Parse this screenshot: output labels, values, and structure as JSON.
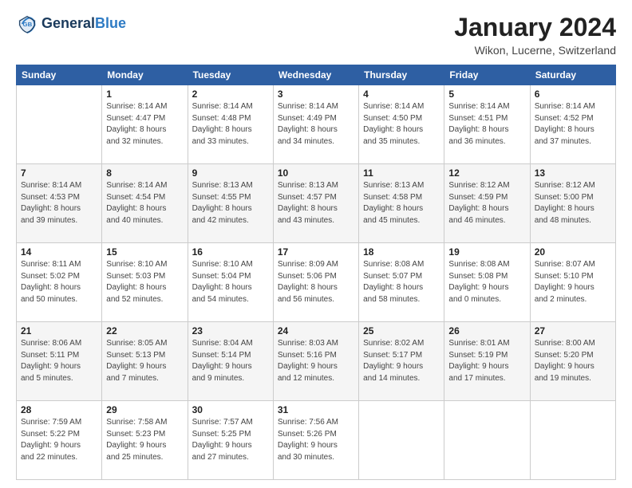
{
  "header": {
    "logo": {
      "line1": "General",
      "line2": "Blue"
    },
    "title": "January 2024",
    "subtitle": "Wikon, Lucerne, Switzerland"
  },
  "weekdays": [
    "Sunday",
    "Monday",
    "Tuesday",
    "Wednesday",
    "Thursday",
    "Friday",
    "Saturday"
  ],
  "weeks": [
    [
      {
        "day": "",
        "info": ""
      },
      {
        "day": "1",
        "info": "Sunrise: 8:14 AM\nSunset: 4:47 PM\nDaylight: 8 hours\nand 32 minutes."
      },
      {
        "day": "2",
        "info": "Sunrise: 8:14 AM\nSunset: 4:48 PM\nDaylight: 8 hours\nand 33 minutes."
      },
      {
        "day": "3",
        "info": "Sunrise: 8:14 AM\nSunset: 4:49 PM\nDaylight: 8 hours\nand 34 minutes."
      },
      {
        "day": "4",
        "info": "Sunrise: 8:14 AM\nSunset: 4:50 PM\nDaylight: 8 hours\nand 35 minutes."
      },
      {
        "day": "5",
        "info": "Sunrise: 8:14 AM\nSunset: 4:51 PM\nDaylight: 8 hours\nand 36 minutes."
      },
      {
        "day": "6",
        "info": "Sunrise: 8:14 AM\nSunset: 4:52 PM\nDaylight: 8 hours\nand 37 minutes."
      }
    ],
    [
      {
        "day": "7",
        "info": "Sunrise: 8:14 AM\nSunset: 4:53 PM\nDaylight: 8 hours\nand 39 minutes."
      },
      {
        "day": "8",
        "info": "Sunrise: 8:14 AM\nSunset: 4:54 PM\nDaylight: 8 hours\nand 40 minutes."
      },
      {
        "day": "9",
        "info": "Sunrise: 8:13 AM\nSunset: 4:55 PM\nDaylight: 8 hours\nand 42 minutes."
      },
      {
        "day": "10",
        "info": "Sunrise: 8:13 AM\nSunset: 4:57 PM\nDaylight: 8 hours\nand 43 minutes."
      },
      {
        "day": "11",
        "info": "Sunrise: 8:13 AM\nSunset: 4:58 PM\nDaylight: 8 hours\nand 45 minutes."
      },
      {
        "day": "12",
        "info": "Sunrise: 8:12 AM\nSunset: 4:59 PM\nDaylight: 8 hours\nand 46 minutes."
      },
      {
        "day": "13",
        "info": "Sunrise: 8:12 AM\nSunset: 5:00 PM\nDaylight: 8 hours\nand 48 minutes."
      }
    ],
    [
      {
        "day": "14",
        "info": "Sunrise: 8:11 AM\nSunset: 5:02 PM\nDaylight: 8 hours\nand 50 minutes."
      },
      {
        "day": "15",
        "info": "Sunrise: 8:10 AM\nSunset: 5:03 PM\nDaylight: 8 hours\nand 52 minutes."
      },
      {
        "day": "16",
        "info": "Sunrise: 8:10 AM\nSunset: 5:04 PM\nDaylight: 8 hours\nand 54 minutes."
      },
      {
        "day": "17",
        "info": "Sunrise: 8:09 AM\nSunset: 5:06 PM\nDaylight: 8 hours\nand 56 minutes."
      },
      {
        "day": "18",
        "info": "Sunrise: 8:08 AM\nSunset: 5:07 PM\nDaylight: 8 hours\nand 58 minutes."
      },
      {
        "day": "19",
        "info": "Sunrise: 8:08 AM\nSunset: 5:08 PM\nDaylight: 9 hours\nand 0 minutes."
      },
      {
        "day": "20",
        "info": "Sunrise: 8:07 AM\nSunset: 5:10 PM\nDaylight: 9 hours\nand 2 minutes."
      }
    ],
    [
      {
        "day": "21",
        "info": "Sunrise: 8:06 AM\nSunset: 5:11 PM\nDaylight: 9 hours\nand 5 minutes."
      },
      {
        "day": "22",
        "info": "Sunrise: 8:05 AM\nSunset: 5:13 PM\nDaylight: 9 hours\nand 7 minutes."
      },
      {
        "day": "23",
        "info": "Sunrise: 8:04 AM\nSunset: 5:14 PM\nDaylight: 9 hours\nand 9 minutes."
      },
      {
        "day": "24",
        "info": "Sunrise: 8:03 AM\nSunset: 5:16 PM\nDaylight: 9 hours\nand 12 minutes."
      },
      {
        "day": "25",
        "info": "Sunrise: 8:02 AM\nSunset: 5:17 PM\nDaylight: 9 hours\nand 14 minutes."
      },
      {
        "day": "26",
        "info": "Sunrise: 8:01 AM\nSunset: 5:19 PM\nDaylight: 9 hours\nand 17 minutes."
      },
      {
        "day": "27",
        "info": "Sunrise: 8:00 AM\nSunset: 5:20 PM\nDaylight: 9 hours\nand 19 minutes."
      }
    ],
    [
      {
        "day": "28",
        "info": "Sunrise: 7:59 AM\nSunset: 5:22 PM\nDaylight: 9 hours\nand 22 minutes."
      },
      {
        "day": "29",
        "info": "Sunrise: 7:58 AM\nSunset: 5:23 PM\nDaylight: 9 hours\nand 25 minutes."
      },
      {
        "day": "30",
        "info": "Sunrise: 7:57 AM\nSunset: 5:25 PM\nDaylight: 9 hours\nand 27 minutes."
      },
      {
        "day": "31",
        "info": "Sunrise: 7:56 AM\nSunset: 5:26 PM\nDaylight: 9 hours\nand 30 minutes."
      },
      {
        "day": "",
        "info": ""
      },
      {
        "day": "",
        "info": ""
      },
      {
        "day": "",
        "info": ""
      }
    ]
  ]
}
